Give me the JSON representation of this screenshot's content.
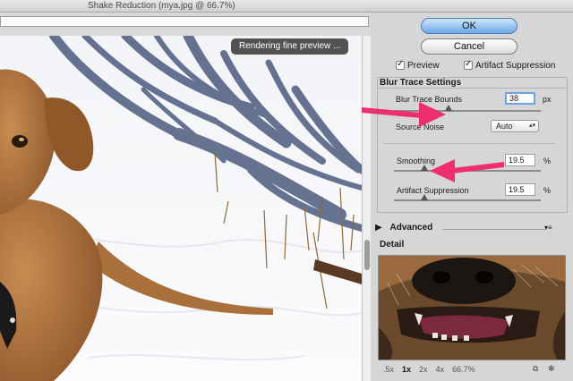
{
  "window": {
    "title": "Shake Reduction (mya.jpg @ 66.7%)"
  },
  "preview": {
    "badge": "Rendering fine preview ..."
  },
  "actions": {
    "ok_label": "OK",
    "cancel_label": "Cancel"
  },
  "options": {
    "preview": {
      "label": "Preview",
      "checked": true
    },
    "artifact_suppression": {
      "label": "Artifact Suppression",
      "checked": true
    }
  },
  "blur_trace": {
    "title": "Blur Trace Settings",
    "bounds": {
      "label": "Blur Trace Bounds",
      "value": "38",
      "unit": "px"
    },
    "source_noise": {
      "label": "Source Noise",
      "selected": "Auto"
    },
    "smoothing": {
      "label": "Smoothing",
      "value": "19.5",
      "unit": "%"
    },
    "artifact_suppression": {
      "label": "Artifact Suppression",
      "value": "19.5",
      "unit": "%"
    }
  },
  "advanced": {
    "label": "Advanced"
  },
  "detail": {
    "title": "Detail",
    "zoom_levels": [
      ".5x",
      "1x",
      "2x",
      "4x",
      "66.7%"
    ],
    "selected_zoom": "1x"
  },
  "colors": {
    "annotation_arrow": "#ee2f6e",
    "ok_button": "#5ea2ec"
  }
}
